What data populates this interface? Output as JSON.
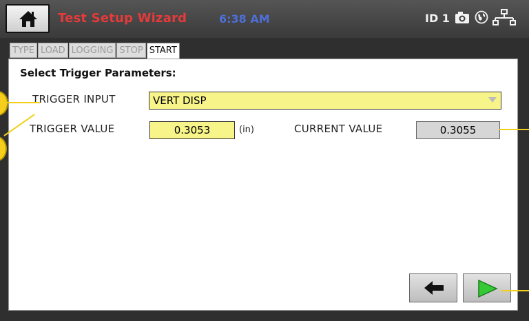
{
  "header": {
    "title": "Test Setup Wizard",
    "time": "6:38 AM",
    "id_label": "ID 1",
    "icons": [
      "home-icon",
      "camera-icon",
      "globe-icon",
      "network-icon"
    ]
  },
  "tabs": [
    {
      "label": "TYPE",
      "active": false
    },
    {
      "label": "LOAD",
      "active": false
    },
    {
      "label": "LOGGING",
      "active": false
    },
    {
      "label": "STOP",
      "active": false
    },
    {
      "label": "START",
      "active": true
    }
  ],
  "form": {
    "heading": "Select Trigger Parameters:",
    "trigger_input_label": "TRIGGER INPUT",
    "trigger_input_value": "VERT DISP",
    "trigger_value_label": "TRIGGER VALUE",
    "trigger_value": "0.3053",
    "trigger_unit": "(in)",
    "current_value_label": "CURRENT VALUE",
    "current_value": "0.3055"
  },
  "nav": {
    "back_icon": "arrow-left-icon",
    "next_icon": "play-icon"
  },
  "colors": {
    "title": "#e63a3a",
    "clock": "#4e6fd6",
    "field_yellow": "#f7f48a",
    "next_green": "#2fc02f",
    "callout": "#f5cf1c"
  }
}
